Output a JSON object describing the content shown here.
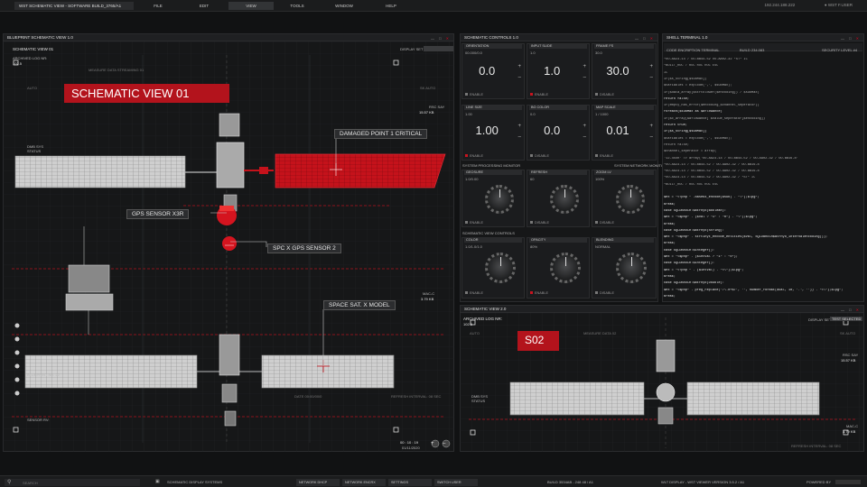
{
  "topbar": {
    "title": "WST SCHEMATIC VIEW - SOFTWARE BUILD_3765/A1",
    "menu": [
      "FILE",
      "EDIT",
      "VIEW",
      "TOOLS",
      "WINDOW",
      "HELP"
    ],
    "active_menu": "VIEW",
    "ip": "192.244.188.222",
    "user": "WST F.USER"
  },
  "blueprint": {
    "header": "BLUEPRINT SCHEMATIC VIEW 1.0",
    "sub_title": "SCHEMATIC VIEW 01",
    "archived_log": "ARCHIVED LOG NR:",
    "archived_val": "102.5",
    "display_set": "DISPLAY SET",
    "measure_stream": "MEASURE DATA STREAMING 01",
    "auto": "AUTO",
    "sk_auto": "SK AUTO",
    "red_title": "SCHEMATIC VIEW 01",
    "rsc": "RSC SAY",
    "rsc_val": "15.57 KB",
    "mac": "MAC-C",
    "mac_val": "3.79 KB",
    "dmb": "DMB SYS STATUS",
    "blueprint_nr": "BLUEPRINT NR. 22",
    "sensor": "SENSOR RV:",
    "date_lbl": "DATE 00:00/00/0",
    "refresh": "REFRESH INTERVAL: 08 SEC",
    "timestamp": "00 : 10 : 19",
    "date": "01/11/2020",
    "callouts": {
      "damaged": "DAMAGED POINT 1 CRITICAL",
      "gps": "GPS SENSOR X3R",
      "spc": "SPC X GPS SENSOR 2",
      "space": "SPACE SAT. X MODEL"
    }
  },
  "controls": {
    "header": "SCHEMATIC CONTROLS 1.0",
    "row1": [
      {
        "label": "ORIENTATION",
        "val": "00.000/0.0",
        "big": "0.0"
      },
      {
        "label": "INPUT SLIDE",
        "val": "1.0",
        "big": "1.0"
      },
      {
        "label": "FRAME FS",
        "val": "30.0",
        "big": "30.0"
      }
    ],
    "row2": [
      {
        "label": "LINE SIZE",
        "val": "1.00",
        "big": "1.00"
      },
      {
        "label": "BG COLOR",
        "val": "0.0",
        "big": "0.0"
      },
      {
        "label": "MAP SCALE",
        "val": "1 / 1000",
        "big": "0.01"
      }
    ],
    "enable": "ENABLE",
    "disable": "DISABLE",
    "proc_monitor": "SYSTEM PROCESSING MONITOR",
    "net_monitor": "SYSTEM NETWORK MONITOR",
    "row3": [
      {
        "label": "GEOSURE",
        "val": "1.0/0.00"
      },
      {
        "label": "REFRESH",
        "val": "60"
      },
      {
        "label": "ZOOM LV",
        "val": "100%"
      }
    ],
    "view_controls": "SCHEMATIC VIEW CONTROLS",
    "row4": [
      {
        "label": "COLOR",
        "val": "1.0/1.0/1.0"
      },
      {
        "label": "OPACITY",
        "val": "80%"
      },
      {
        "label": "BLENDING",
        "val": "NORMAL"
      }
    ]
  },
  "terminal": {
    "header": "SHELL TERMINAL 1.0",
    "enc": "CODE ENCRIPTION TERMINAL",
    "build": "BUILD 234.083",
    "security": "SECURITY LEVEL #4",
    "lines": [
      "*OO-AA23-14 / OO-BB44-52 OO-AA02-32 *ST* IC",
      "*BUILT_RUC / RUC RUC RUC ESC",
      "IC",
      "if($s_string[$subMax])",
      "$variables = explode(',', $subMax);",
      "if($data_array[$strtolower($encoding]) / $subMax)",
      "return false;",
      "if(empty_has_error($encoding_$channel_seperator))",
      "foreach($subMax as $aflowance)",
      "if($c_array[$aflowance] $value_seperator[$encoding])",
      "return true;",
      "if($s_string[$subMax])",
      "$variables = explode(',', $subMax);",
      "return false;",
      "$channel_seperator = array(",
      "'12-4XUR' => array('OO-AA23-14 / OO-BB44-52 / OO-AA02-32 / OO-BB16-8'",
      "*OO-AA23-14 / OO-BB44-52 / OO-AA02-32 / OO-BB16-8",
      "*OO-AA23-14 / OO-BB44-52 / OO-AA02-32 / OO-BB16-8",
      "*OO-AA23-14 / OO-BB44-52 / OO-AA02-32 / *ST* IC",
      "*BUILT_RUC / RUC RUC RUC ESC",
      "",
      "$ex = \"<?php \" .base64_encode($sub) . \"\\\");$lpg\";",
      "break;",
      "case SQLDBRUCH:$atrhyo(Boolean):",
      "$ex = \"<$php\" . ($val ? \"1\" : \"0\") . \"\\\");$lpg\";",
      "break;",
      "case SQLDBRUCH:$atrhyo(String):",
      "$ex = \"<$php\" . strtinyt_encode_entities($val, SQLDBRUCH$atrhyo_internalencoding());",
      "break;",
      "case SQLDBRUCH:$integer():",
      "$ex = \"<$php\" . ($intval ? \"1\" : \"0\");",
      "case SQLDBRUCH:$integer():",
      "$ex = \"<?php \" . ($intVal) . \"<\\\");$lpg\";",
      "break;",
      "case SQLDBRUCH:$atrhyo(Double):",
      "$ex = \"<$php\" . preg_replace('/\\.0+$/', '', number_format($val, 10, '.', '')) . \"<\\\");$lpg\";",
      "break;"
    ]
  },
  "view2": {
    "header": "SCHEMATIC VIEW 2.0",
    "archived_log": "ARCHIVED LOG NR:",
    "archived_val": "102.5",
    "display_set": "DISPLAY SET",
    "display_val": "TEST SELECTED",
    "measure": "MEASURE DATA 02",
    "auto": "AUTO",
    "sk_auto": "SK AUTO",
    "badge": "S02",
    "rsc": "RSC SAY",
    "rsc_val": "15.57 KB",
    "mac": "MAC-C",
    "mac_val": "3.79 KB",
    "dmb": "DMB SYS STATUS",
    "refresh": "REFRESH INTERVAL: 08 SEC"
  },
  "bottombar": {
    "search": "SEARCH",
    "system": "SCHEMATIC DISPLAY SYSTEMS",
    "buttons": [
      "NETWORK DHCP",
      "NETWORK ENCRX",
      "SETTINGS",
      "SWITCH USER"
    ],
    "build": "BUILD 3534AB - 248 48 / A1",
    "version": "WLT DISPLAY - WST VIEWER VERSION 3.5.2 / A1",
    "powered": "POWERED BY"
  },
  "colors": {
    "accent": "#c8141f",
    "panel": "#161718",
    "bg": "#111213"
  }
}
